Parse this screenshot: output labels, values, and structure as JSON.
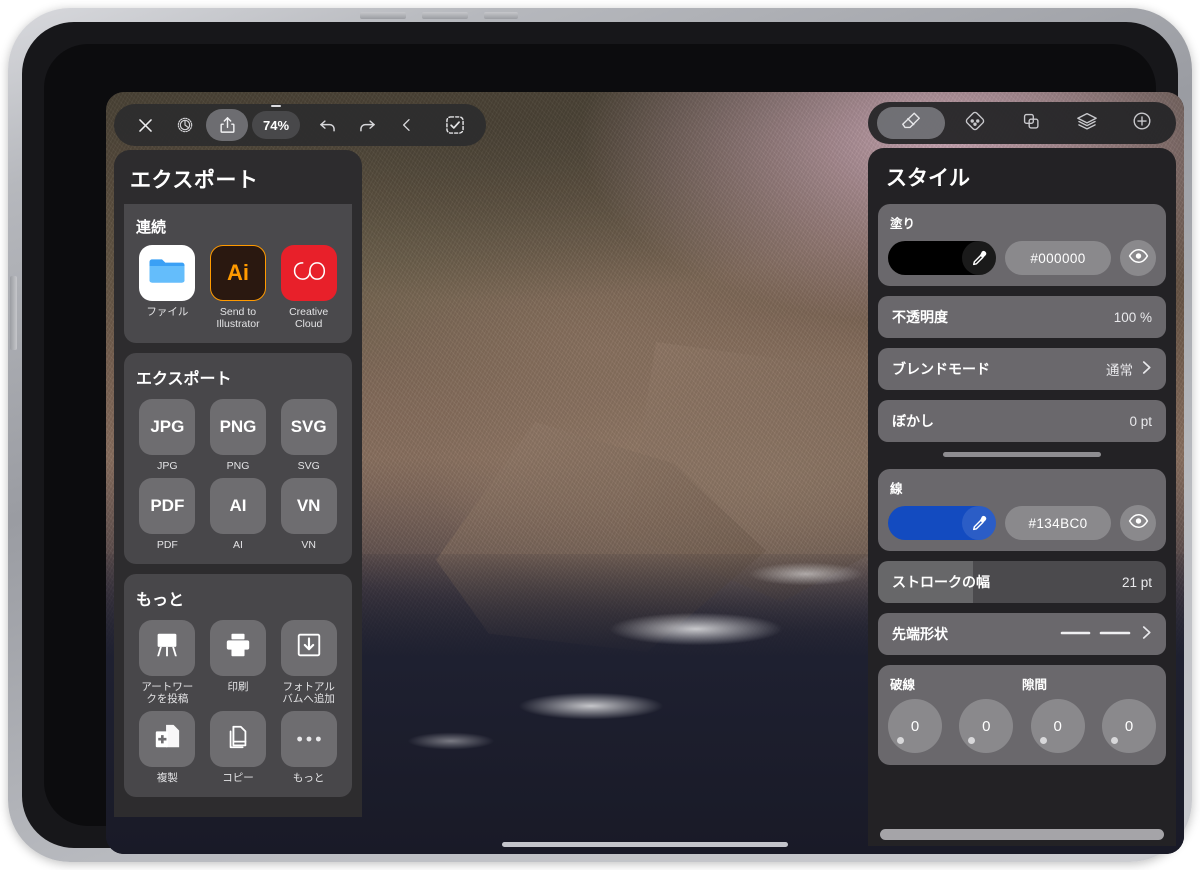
{
  "app": {
    "device": "iPad",
    "canvas_background": "coastal-cliff-photo"
  },
  "toolbar": {
    "close_label": "",
    "settings_label": "",
    "share_label": "",
    "zoom_label": "74%",
    "undo_label": "",
    "redo_label": "",
    "back_label": "",
    "select_label": "",
    "icons": {
      "close": "close-icon",
      "settings": "gear-icon",
      "share": "share-icon",
      "undo": "undo-icon",
      "redo": "redo-icon",
      "back": "chevron-left-icon",
      "select": "selection-check-icon"
    }
  },
  "export_panel": {
    "title": "エクスポート",
    "sections": [
      {
        "title": "連続",
        "items": [
          {
            "label": "ファイル",
            "tile_text": "",
            "icon": "folder-icon",
            "style": "files"
          },
          {
            "label": "Send to Illustrator",
            "tile_text": "Ai",
            "icon": "illustrator-icon",
            "style": "ai"
          },
          {
            "label": "Creative Cloud",
            "tile_text": "",
            "icon": "creative-cloud-icon",
            "style": "cc"
          }
        ]
      },
      {
        "title": "エクスポート",
        "items": [
          {
            "label": "JPG",
            "tile_text": "JPG",
            "icon": "jpg-icon",
            "style": "plain"
          },
          {
            "label": "PNG",
            "tile_text": "PNG",
            "icon": "png-icon",
            "style": "plain"
          },
          {
            "label": "SVG",
            "tile_text": "SVG",
            "icon": "svg-icon",
            "style": "plain"
          },
          {
            "label": "PDF",
            "tile_text": "PDF",
            "icon": "pdf-icon",
            "style": "plain"
          },
          {
            "label": "AI",
            "tile_text": "AI",
            "icon": "ai-file-icon",
            "style": "plain"
          },
          {
            "label": "VN",
            "tile_text": "VN",
            "icon": "vn-file-icon",
            "style": "plain"
          }
        ]
      },
      {
        "title": "もっと",
        "items": [
          {
            "label": "アートワークを投稿",
            "tile_text": "",
            "icon": "easel-icon",
            "style": "plain"
          },
          {
            "label": "印刷",
            "tile_text": "",
            "icon": "printer-icon",
            "style": "plain"
          },
          {
            "label": "フォトアルバムへ追加",
            "tile_text": "",
            "icon": "save-to-photos-icon",
            "style": "plain"
          },
          {
            "label": "複製",
            "tile_text": "",
            "icon": "duplicate-icon",
            "style": "plain"
          },
          {
            "label": "コピー",
            "tile_text": "",
            "icon": "copy-icon",
            "style": "plain"
          },
          {
            "label": "もっと",
            "tile_text": "",
            "icon": "ellipsis-icon",
            "style": "plain"
          }
        ]
      }
    ]
  },
  "style_panel": {
    "title": "スタイル",
    "tabs": [
      {
        "name": "style-tab",
        "icon": "paint-brush-icon",
        "active": true
      },
      {
        "name": "node-tab",
        "icon": "anchor-point-icon",
        "active": false
      },
      {
        "name": "boolean-tab",
        "icon": "shapes-overlap-icon",
        "active": false
      },
      {
        "name": "layers-tab",
        "icon": "layers-icon",
        "active": false
      },
      {
        "name": "add-tab",
        "icon": "plus-circle-icon",
        "active": false
      }
    ],
    "fill": {
      "label": "塗り",
      "hex": "#000000",
      "color": "#000000",
      "visible": true
    },
    "opacity": {
      "label": "不透明度",
      "value": "100 %"
    },
    "blend_mode": {
      "label": "ブレンドモード",
      "value": "通常"
    },
    "blur": {
      "label": "ぼかし",
      "value": "0 pt"
    },
    "stroke": {
      "label": "線",
      "hex": "#134BC0",
      "color": "#134BC0",
      "visible": true
    },
    "stroke_width": {
      "label": "ストロークの幅",
      "value": "21 pt",
      "fill_percent": 33
    },
    "cap_shape": {
      "label": "先端形状",
      "value": ""
    },
    "dash": {
      "dash_label": "破線",
      "gap_label": "隙間",
      "values": [
        "0",
        "0",
        "0",
        "0"
      ]
    }
  },
  "colors": {
    "panel_bg": "#2d2c2e",
    "card_bg": "#6a686c",
    "accent_blue": "#134BC0",
    "toolbar_bg": "#2c2c2e",
    "illustrator_orange": "#ff9a00",
    "creative_cloud_red": "#e8202a"
  }
}
